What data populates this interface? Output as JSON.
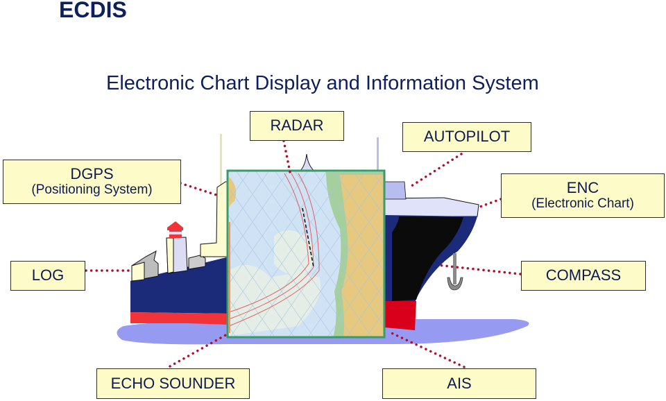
{
  "header": {
    "title": "ECDIS",
    "subtitle": "Electronic Chart Display and Information System"
  },
  "components": {
    "radar": {
      "label": "RADAR"
    },
    "autopilot": {
      "label": "AUTOPILOT"
    },
    "dgps": {
      "label": "DGPS",
      "sublabel": "(Positioning System)"
    },
    "enc": {
      "label": "ENC",
      "sublabel": "(Electronic Chart)"
    },
    "log": {
      "label": "LOG"
    },
    "compass": {
      "label": "COMPASS"
    },
    "echo_sounder": {
      "label": "ECHO SOUNDER"
    },
    "ais": {
      "label": "AIS"
    }
  },
  "colors": {
    "title": "#0d1f5c",
    "box_fill": "#fdfcc8",
    "connector": "#b0102a",
    "hull_navy": "#1c2a7a",
    "hull_red": "#f2343a",
    "water": "#8c8ff0",
    "chart_frame": "#3a9a6a",
    "chart_sea": "#cfe3f5",
    "chart_land": "#e6c87e"
  }
}
